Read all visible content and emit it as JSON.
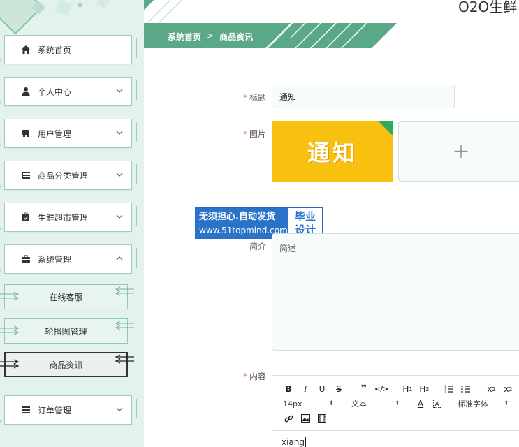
{
  "app": {
    "title": "O2O生鲜"
  },
  "breadcrumb": {
    "home": "系统首页",
    "separator": ">",
    "current": "商品资讯"
  },
  "sidebar": {
    "items": [
      {
        "label": "系统首页",
        "icon": "home-icon"
      },
      {
        "label": "个人中心",
        "icon": "user-icon"
      },
      {
        "label": "用户管理",
        "icon": "users-icon"
      },
      {
        "label": "商品分类管理",
        "icon": "list-icon"
      },
      {
        "label": "生鲜超市管理",
        "icon": "clipboard-icon"
      },
      {
        "label": "系统管理",
        "icon": "briefcase-icon"
      },
      {
        "label": "订单管理",
        "icon": "menu-icon"
      }
    ],
    "sub_items": [
      {
        "label": "在线客服"
      },
      {
        "label": "轮播图管理"
      },
      {
        "label": "商品资讯"
      }
    ]
  },
  "form": {
    "title_label": "标题",
    "title_value": "通知",
    "image_label": "图片",
    "image_text": "通知",
    "summary_label": "简介",
    "summary_value": "简述",
    "content_label": "内容",
    "content_value": "xiang"
  },
  "watermark": {
    "line1": "无须担心.自动发货",
    "line2": "www.51topmind.com",
    "right1": "毕业",
    "right2": "设计"
  },
  "editor": {
    "font_size": "14px",
    "text_type": "文本",
    "font_family": "标准字体"
  },
  "colors": {
    "accent": "#5aa887",
    "sidebar_bg": "#e3f2ec",
    "required": "#f56c6c"
  }
}
